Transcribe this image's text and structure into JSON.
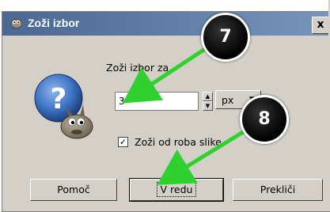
{
  "window": {
    "title": "Zoži izbor",
    "close_label": "x"
  },
  "form": {
    "shrink_label": "Zoži izbor za",
    "shrink_value": "3",
    "unit_value": "px",
    "from_border_label": "Zoži od roba slike",
    "from_border_checked": true
  },
  "buttons": {
    "help": "Pomoč",
    "ok": "V redu",
    "cancel": "Prekliči"
  },
  "annotations": {
    "callout_7": "7",
    "callout_8": "8"
  },
  "colors": {
    "titlebar": "#5d7ba5",
    "dialog_bg": "#d4d0c8",
    "arrow": "#2fd02f"
  },
  "icons": {
    "app": "gimp-wilber-icon",
    "dialog": "question-wilber-icon"
  }
}
